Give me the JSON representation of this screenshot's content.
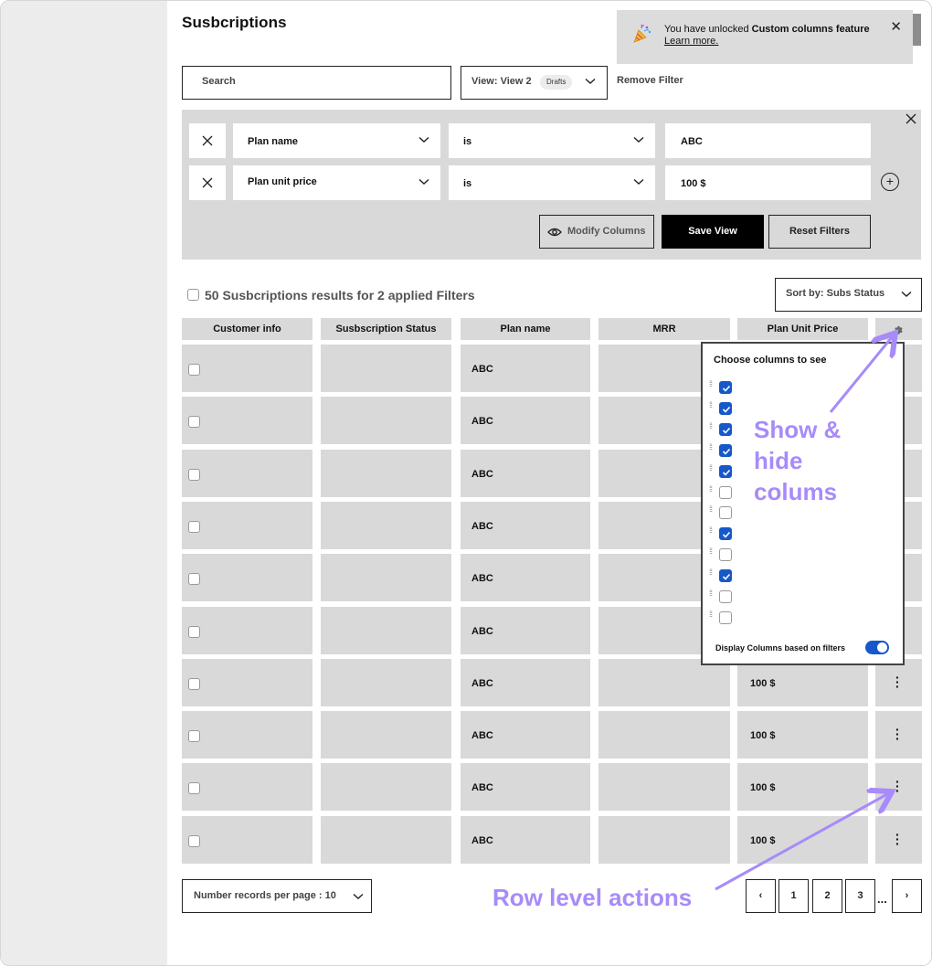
{
  "page": {
    "title": "Susbcriptions"
  },
  "toast": {
    "message_prefix": "You have unlocked ",
    "message_bold": "Custom columns feature",
    "link": "Learn more.",
    "icon": "party-popper-icon"
  },
  "toolbar": {
    "search_placeholder": "Search",
    "view_label": "View: View 2",
    "view_chip": "Drafts",
    "remove_filter": "Remove Filter"
  },
  "filters": [
    {
      "field": "Plan name",
      "operator": "is",
      "value": "ABC"
    },
    {
      "field": "Plan unit price",
      "operator": "is",
      "value": "100 $"
    }
  ],
  "filter_actions": {
    "modify_columns": "Modify Columns",
    "save_view": "Save View",
    "reset_filters": "Reset Filters"
  },
  "results": {
    "summary": "50 Susbcriptions results for 2 applied Filters",
    "sort_label": "Sort by: Subs Status"
  },
  "table": {
    "columns": [
      "Customer info",
      "Susbscription Status",
      "Plan name",
      "MRR",
      "Plan Unit Price"
    ],
    "rows": [
      {
        "plan": "ABC",
        "price": ""
      },
      {
        "plan": "ABC",
        "price": ""
      },
      {
        "plan": "ABC",
        "price": ""
      },
      {
        "plan": "ABC",
        "price": ""
      },
      {
        "plan": "ABC",
        "price": ""
      },
      {
        "plan": "ABC",
        "price": ""
      },
      {
        "plan": "ABC",
        "price": "100 $"
      },
      {
        "plan": "ABC",
        "price": "100 $"
      },
      {
        "plan": "ABC",
        "price": "100 $"
      },
      {
        "plan": "ABC",
        "price": "100 $"
      }
    ]
  },
  "column_chooser": {
    "title": "Choose columns to see",
    "checked": [
      true,
      true,
      true,
      true,
      true,
      false,
      false,
      true,
      false,
      true,
      false,
      false
    ],
    "footer": "Display Columns based on filters",
    "toggle_on": true
  },
  "annotations": {
    "show_hide_line1": "Show &",
    "show_hide_line2": "hide",
    "show_hide_line3": "colums",
    "row_actions": "Row level actions",
    "color": "#a78bfa"
  },
  "pagination": {
    "per_page": "Number records per page : 10",
    "prev": "‹",
    "pages": [
      "1",
      "2",
      "3"
    ],
    "ellipsis": "...",
    "next": "›"
  },
  "colors": {
    "accent": "#1658c9",
    "primary_button": "#000000",
    "panel": "#d9d9d9"
  }
}
